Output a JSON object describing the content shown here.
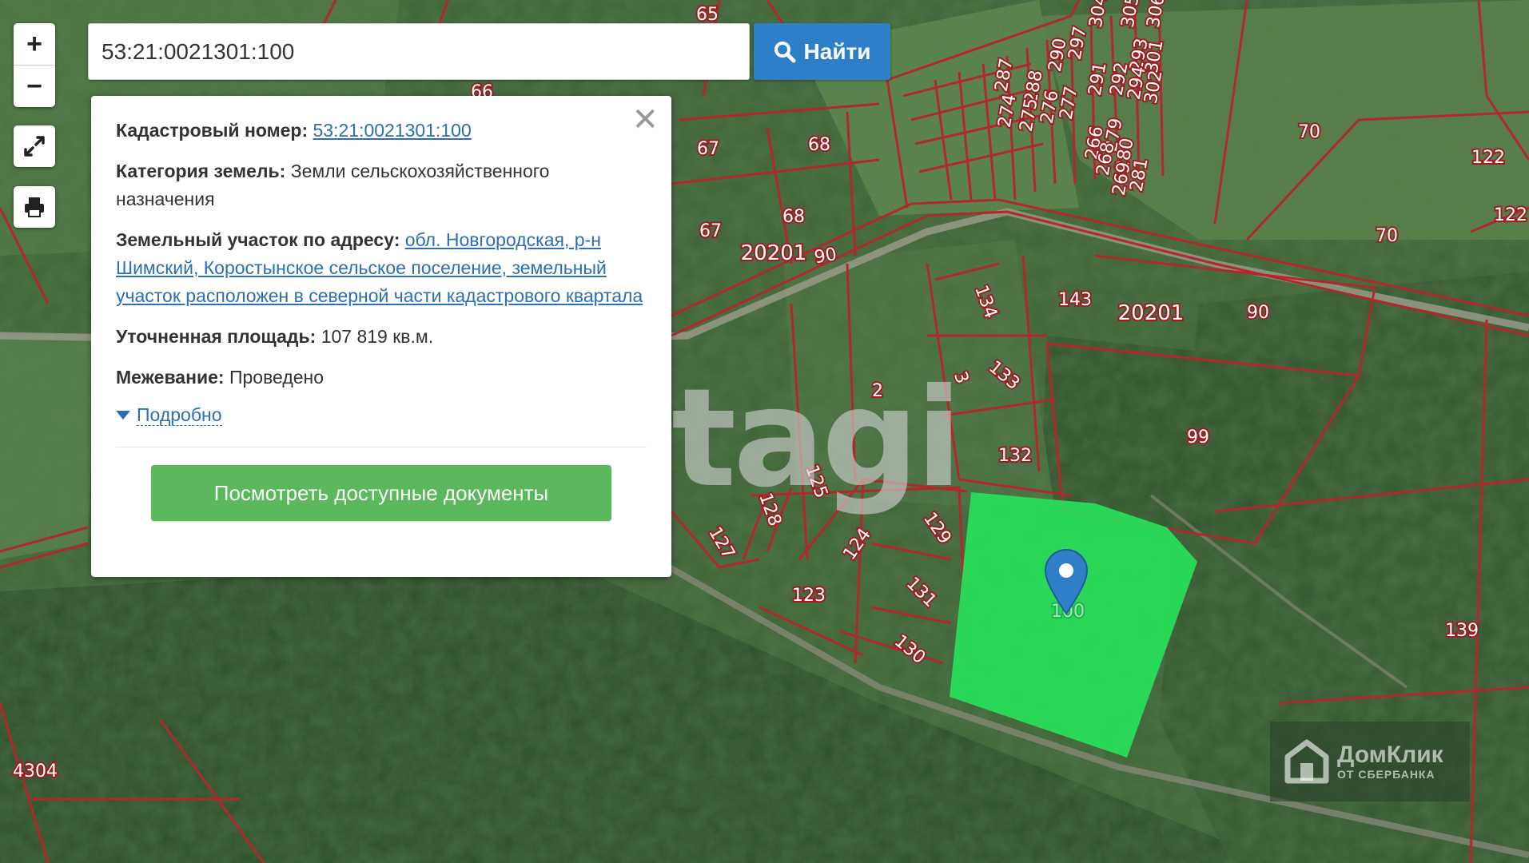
{
  "map": {
    "parcel_labels": [
      "65",
      "66",
      "67",
      "68",
      "67",
      "68",
      "90",
      "70",
      "70",
      "122",
      "122",
      "90",
      "143",
      "134",
      "133",
      "3",
      "2",
      "132",
      "99",
      "125",
      "128",
      "127",
      "124",
      "129",
      "123",
      "131",
      "130",
      "139",
      "4304",
      "20201",
      "20201",
      "287",
      "288",
      "274",
      "275",
      "276",
      "277",
      "290",
      "297",
      "291",
      "292",
      "293",
      "301",
      "294",
      "302",
      "266",
      "279",
      "268",
      "280",
      "269",
      "281",
      "304",
      "305",
      "306",
      "100"
    ],
    "selected_parcel_label": "100",
    "watermark_text": "tagi",
    "brand": {
      "name": "ДомКлик",
      "tagline": "ОТ СБЕРБАНКА"
    },
    "colors": {
      "parcel_border": "#b2282d",
      "selected_parcel": "#28e05a",
      "marker": "#2f7fc8"
    }
  },
  "controls": {
    "zoom_in": "+",
    "zoom_out": "−",
    "fullscreen_icon": "expand-icon",
    "print_icon": "printer-icon"
  },
  "search": {
    "value": "53:21:0021301:100",
    "button_label": "Найти",
    "button_icon": "search-icon"
  },
  "popup": {
    "cadastral_label": "Кадастровый номер:",
    "cadastral_value": "53:21:0021301:100",
    "category_label": "Категория земель:",
    "category_value": "Земли сельскохозяйственного назначения",
    "address_label": "Земельный участок по адресу:",
    "address_value": "обл. Новгородская, р-н Шимский, Коростынское сельское поселение, земельный участок расположен в северной части кадастрового квартала",
    "area_label": "Уточненная площадь:",
    "area_value": "107 819 кв.м.",
    "survey_label": "Межевание:",
    "survey_value": "Проведено",
    "more_label": "Подробно",
    "docs_button": "Посмотреть доступные документы",
    "close_icon": "close-icon"
  }
}
